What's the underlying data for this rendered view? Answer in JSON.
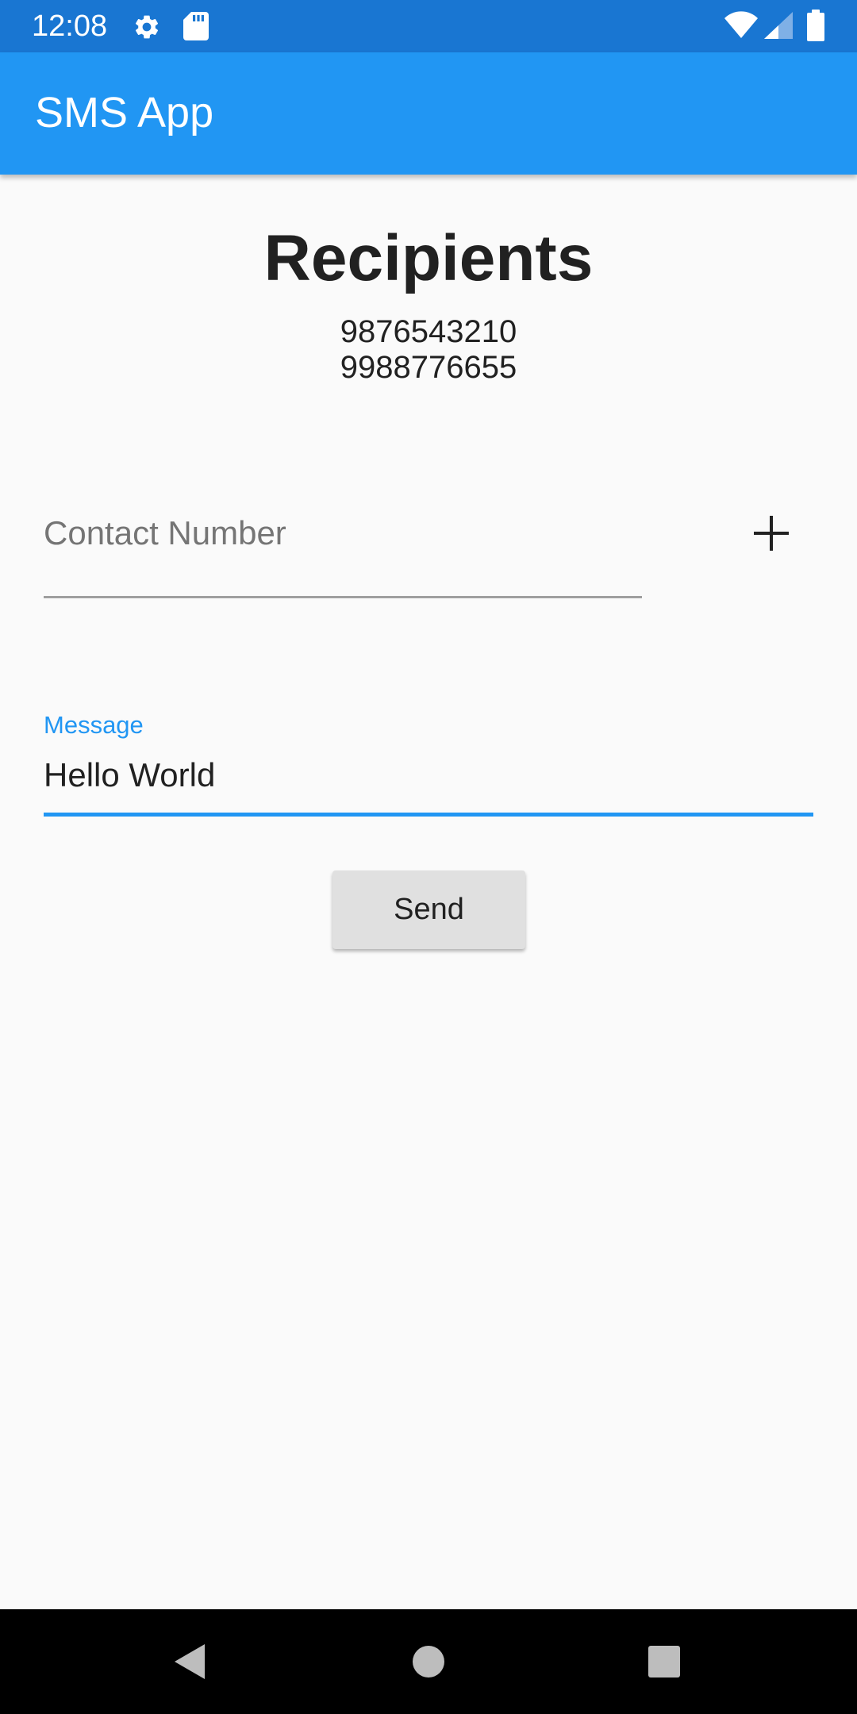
{
  "status_bar": {
    "time": "12:08",
    "left_icons": [
      "gear-icon",
      "sd-card-icon"
    ],
    "right_icons": [
      "wifi-icon",
      "cell-signal-icon",
      "battery-icon"
    ]
  },
  "app_bar": {
    "title": "SMS App",
    "color": "#2196f3"
  },
  "recipients": {
    "title": "Recipients",
    "numbers": [
      "9876543210",
      "9988776655"
    ]
  },
  "contact_field": {
    "placeholder": "Contact Number",
    "value": "",
    "add_icon": "plus-icon"
  },
  "message_field": {
    "label": "Message",
    "value": "Hello World",
    "accent_color": "#2196f3"
  },
  "send_button": {
    "label": "Send"
  },
  "nav_bar": {
    "icons": [
      "back-icon",
      "home-icon",
      "recents-icon"
    ]
  }
}
